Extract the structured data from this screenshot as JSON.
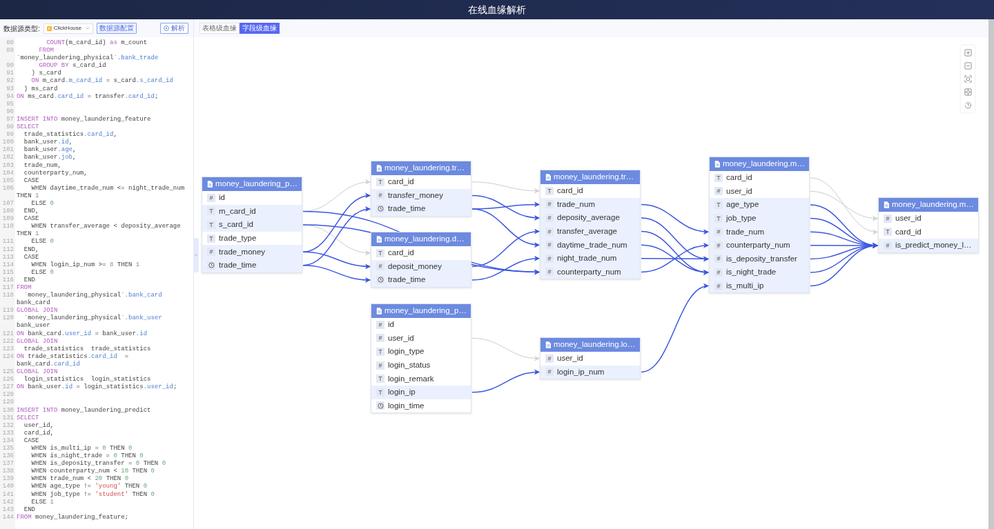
{
  "header": {
    "title": "在线血缘解析"
  },
  "toolbar": {
    "datasource_label": "数据源类型:",
    "datasource_value": "ClickHouse",
    "config_button": "数据源配置",
    "parse_button": "解析"
  },
  "view_tabs": [
    {
      "label": "表格级血缘",
      "selected": false
    },
    {
      "label": "字段级血缘",
      "selected": true
    }
  ],
  "collapse_handle": "<",
  "code": [
    {
      "n": "88",
      "parts": [
        {
          "kind": "kw",
          "text": "        COUNT"
        },
        {
          "kind": "txt",
          "text": "(m_card_id) "
        },
        {
          "kind": "kw",
          "text": "as"
        },
        {
          "kind": "txt",
          "text": " m_count"
        }
      ]
    },
    {
      "n": "89",
      "parts": [
        {
          "kind": "kw",
          "text": "      FROM"
        }
      ]
    },
    {
      "parts": [
        {
          "kind": "txt",
          "text": "`money_laundering_physical`"
        },
        {
          "kind": "fld",
          "text": ".bank_trade"
        }
      ]
    },
    {
      "n": "90",
      "parts": [
        {
          "kind": "kw",
          "text": "      GROUP BY"
        },
        {
          "kind": "txt",
          "text": " s_card_id"
        }
      ]
    },
    {
      "n": "91",
      "parts": [
        {
          "kind": "txt",
          "text": "    ) s_card"
        }
      ]
    },
    {
      "n": "92",
      "parts": [
        {
          "kind": "kw",
          "text": "    ON"
        },
        {
          "kind": "txt",
          "text": " m_card"
        },
        {
          "kind": "fld",
          "text": ".m_card_id"
        },
        {
          "kind": "txt",
          "text": " = s_card"
        },
        {
          "kind": "fld",
          "text": ".s_card_id"
        }
      ]
    },
    {
      "n": "93",
      "parts": [
        {
          "kind": "txt",
          "text": "  ) ms_card"
        }
      ]
    },
    {
      "n": "94",
      "parts": [
        {
          "kind": "kw",
          "text": "ON"
        },
        {
          "kind": "txt",
          "text": " ms_card"
        },
        {
          "kind": "fld",
          "text": ".card_id"
        },
        {
          "kind": "txt",
          "text": " = transfer"
        },
        {
          "kind": "fld",
          "text": ".card_id"
        },
        {
          "kind": "txt",
          "text": ";"
        }
      ]
    },
    {
      "n": "95"
    },
    {
      "n": "96"
    },
    {
      "n": "97",
      "parts": [
        {
          "kind": "kw",
          "text": "INSERT INTO"
        },
        {
          "kind": "txt",
          "text": " money_laundering_feature"
        }
      ]
    },
    {
      "n": "98",
      "parts": [
        {
          "kind": "kw",
          "text": "SELECT"
        }
      ]
    },
    {
      "n": "99",
      "parts": [
        {
          "kind": "txt",
          "text": "  trade_statistics"
        },
        {
          "kind": "fld",
          "text": ".card_id"
        },
        {
          "kind": "txt",
          "text": ","
        }
      ]
    },
    {
      "n": "100",
      "parts": [
        {
          "kind": "txt",
          "text": "  bank_user"
        },
        {
          "kind": "fld",
          "text": ".id"
        },
        {
          "kind": "txt",
          "text": ","
        }
      ]
    },
    {
      "n": "101",
      "parts": [
        {
          "kind": "txt",
          "text": "  bank_user"
        },
        {
          "kind": "fld",
          "text": ".age"
        },
        {
          "kind": "txt",
          "text": ","
        }
      ]
    },
    {
      "n": "102",
      "parts": [
        {
          "kind": "txt",
          "text": "  bank_user"
        },
        {
          "kind": "fld",
          "text": ".job"
        },
        {
          "kind": "txt",
          "text": ","
        }
      ]
    },
    {
      "n": "103",
      "parts": [
        {
          "kind": "txt",
          "text": "  trade_num,"
        }
      ]
    },
    {
      "n": "104",
      "parts": [
        {
          "kind": "txt",
          "text": "  counterparty_num,"
        }
      ]
    },
    {
      "n": "105",
      "parts": [
        {
          "kind": "txt",
          "text": "  CASE"
        }
      ]
    },
    {
      "n": "106",
      "parts": [
        {
          "kind": "txt",
          "text": "    WHEN daytime_trade_num <= night_trade_num"
        }
      ]
    },
    {
      "parts": [
        {
          "kind": "txt",
          "text": "THEN "
        },
        {
          "kind": "num",
          "text": "1"
        }
      ]
    },
    {
      "n": "107",
      "parts": [
        {
          "kind": "txt",
          "text": "    ELSE "
        },
        {
          "kind": "num",
          "text": "0"
        }
      ]
    },
    {
      "n": "108",
      "parts": [
        {
          "kind": "txt",
          "text": "  END,"
        }
      ]
    },
    {
      "n": "109",
      "parts": [
        {
          "kind": "txt",
          "text": "  CASE"
        }
      ]
    },
    {
      "n": "110",
      "parts": [
        {
          "kind": "txt",
          "text": "    WHEN transfer_average < deposity_average"
        }
      ]
    },
    {
      "parts": [
        {
          "kind": "txt",
          "text": "THEN "
        },
        {
          "kind": "num",
          "text": "1"
        }
      ]
    },
    {
      "n": "111",
      "parts": [
        {
          "kind": "txt",
          "text": "    ELSE "
        },
        {
          "kind": "num",
          "text": "0"
        }
      ]
    },
    {
      "n": "112",
      "parts": [
        {
          "kind": "txt",
          "text": "  END,"
        }
      ]
    },
    {
      "n": "113",
      "parts": [
        {
          "kind": "txt",
          "text": "  CASE"
        }
      ]
    },
    {
      "n": "114",
      "parts": [
        {
          "kind": "txt",
          "text": "    WHEN login_ip_num >= "
        },
        {
          "kind": "num",
          "text": "8"
        },
        {
          "kind": "txt",
          "text": " THEN "
        },
        {
          "kind": "num",
          "text": "1"
        }
      ]
    },
    {
      "n": "115",
      "parts": [
        {
          "kind": "txt",
          "text": "    ELSE "
        },
        {
          "kind": "num",
          "text": "0"
        }
      ]
    },
    {
      "n": "116",
      "parts": [
        {
          "kind": "txt",
          "text": "  END"
        }
      ]
    },
    {
      "n": "117",
      "parts": [
        {
          "kind": "kw",
          "text": "FROM"
        }
      ]
    },
    {
      "n": "118",
      "parts": [
        {
          "kind": "txt",
          "text": "  `money_laundering_physical`"
        },
        {
          "kind": "fld",
          "text": ".bank_card"
        }
      ]
    },
    {
      "parts": [
        {
          "kind": "txt",
          "text": "bank_card"
        }
      ]
    },
    {
      "n": "119",
      "parts": [
        {
          "kind": "kw",
          "text": "GLOBAL JOIN"
        }
      ]
    },
    {
      "n": "120",
      "parts": [
        {
          "kind": "txt",
          "text": "  `money_laundering_physical`"
        },
        {
          "kind": "fld",
          "text": ".bank_user"
        }
      ]
    },
    {
      "parts": [
        {
          "kind": "txt",
          "text": "bank_user"
        }
      ]
    },
    {
      "n": "121",
      "parts": [
        {
          "kind": "kw",
          "text": "ON"
        },
        {
          "kind": "txt",
          "text": " bank_card"
        },
        {
          "kind": "fld",
          "text": ".user_id"
        },
        {
          "kind": "txt",
          "text": " = bank_user"
        },
        {
          "kind": "fld",
          "text": ".id"
        }
      ]
    },
    {
      "n": "122",
      "parts": [
        {
          "kind": "kw",
          "text": "GLOBAL JOIN"
        }
      ]
    },
    {
      "n": "123",
      "parts": [
        {
          "kind": "txt",
          "text": "  trade_statistics  trade_statistics"
        }
      ]
    },
    {
      "n": "124",
      "parts": [
        {
          "kind": "kw",
          "text": "ON"
        },
        {
          "kind": "txt",
          "text": " trade_statistics"
        },
        {
          "kind": "fld",
          "text": ".card_id"
        },
        {
          "kind": "txt",
          "text": "  ="
        }
      ]
    },
    {
      "parts": [
        {
          "kind": "txt",
          "text": "bank_card"
        },
        {
          "kind": "fld",
          "text": ".card_id"
        }
      ]
    },
    {
      "n": "125",
      "parts": [
        {
          "kind": "kw",
          "text": "GLOBAL JOIN"
        }
      ]
    },
    {
      "n": "126",
      "parts": [
        {
          "kind": "txt",
          "text": "  login_statistics  login_statistics"
        }
      ]
    },
    {
      "n": "127",
      "parts": [
        {
          "kind": "kw",
          "text": "ON"
        },
        {
          "kind": "txt",
          "text": " bank_user"
        },
        {
          "kind": "fld",
          "text": ".id"
        },
        {
          "kind": "txt",
          "text": " = login_statistics"
        },
        {
          "kind": "fld",
          "text": ".user_id"
        },
        {
          "kind": "txt",
          "text": ";"
        }
      ]
    },
    {
      "n": "128"
    },
    {
      "n": "129"
    },
    {
      "n": "130",
      "parts": [
        {
          "kind": "kw",
          "text": "INSERT INTO"
        },
        {
          "kind": "txt",
          "text": " money_laundering_predict"
        }
      ]
    },
    {
      "n": "131",
      "parts": [
        {
          "kind": "kw",
          "text": "SELECT"
        }
      ]
    },
    {
      "n": "132",
      "parts": [
        {
          "kind": "txt",
          "text": "  user_id,"
        }
      ]
    },
    {
      "n": "133",
      "parts": [
        {
          "kind": "txt",
          "text": "  card_id,"
        }
      ]
    },
    {
      "n": "134",
      "parts": [
        {
          "kind": "txt",
          "text": "  CASE"
        }
      ]
    },
    {
      "n": "135",
      "parts": [
        {
          "kind": "txt",
          "text": "    WHEN is_multi_ip = "
        },
        {
          "kind": "num",
          "text": "0"
        },
        {
          "kind": "txt",
          "text": " THEN "
        },
        {
          "kind": "num",
          "text": "0"
        }
      ]
    },
    {
      "n": "136",
      "parts": [
        {
          "kind": "txt",
          "text": "    WHEN is_night_trade = "
        },
        {
          "kind": "num",
          "text": "0"
        },
        {
          "kind": "txt",
          "text": " THEN "
        },
        {
          "kind": "num",
          "text": "0"
        }
      ]
    },
    {
      "n": "137",
      "parts": [
        {
          "kind": "txt",
          "text": "    WHEN is_deposity_transfer = "
        },
        {
          "kind": "num",
          "text": "0"
        },
        {
          "kind": "txt",
          "text": " THEN "
        },
        {
          "kind": "num",
          "text": "0"
        }
      ]
    },
    {
      "n": "138",
      "parts": [
        {
          "kind": "txt",
          "text": "    WHEN counterparty_num < "
        },
        {
          "kind": "num",
          "text": "10"
        },
        {
          "kind": "txt",
          "text": " THEN "
        },
        {
          "kind": "num",
          "text": "0"
        }
      ]
    },
    {
      "n": "139",
      "parts": [
        {
          "kind": "txt",
          "text": "    WHEN trade_num < "
        },
        {
          "kind": "num",
          "text": "20"
        },
        {
          "kind": "txt",
          "text": " THEN "
        },
        {
          "kind": "num",
          "text": "0"
        }
      ]
    },
    {
      "n": "140",
      "parts": [
        {
          "kind": "txt",
          "text": "    WHEN age_type != "
        },
        {
          "kind": "str",
          "text": "'young'"
        },
        {
          "kind": "txt",
          "text": " THEN "
        },
        {
          "kind": "num",
          "text": "0"
        }
      ]
    },
    {
      "n": "141",
      "parts": [
        {
          "kind": "txt",
          "text": "    WHEN job_type != "
        },
        {
          "kind": "str",
          "text": "'student'"
        },
        {
          "kind": "txt",
          "text": " THEN "
        },
        {
          "kind": "num",
          "text": "0"
        }
      ]
    },
    {
      "n": "142",
      "parts": [
        {
          "kind": "txt",
          "text": "    ELSE "
        },
        {
          "kind": "num",
          "text": "1"
        }
      ]
    },
    {
      "n": "143",
      "parts": [
        {
          "kind": "txt",
          "text": "  END"
        }
      ]
    },
    {
      "n": "144",
      "parts": [
        {
          "kind": "kw",
          "text": "FROM"
        },
        {
          "kind": "txt",
          "text": " money_laundering_feature;"
        }
      ]
    }
  ],
  "tables": [
    {
      "title": "money_laundering_p…",
      "fields": [
        {
          "name": "id",
          "kind": "number",
          "glyph": "#",
          "highlighted": false
        },
        {
          "name": "m_card_id",
          "kind": "text",
          "glyph": "T",
          "highlighted": true
        },
        {
          "name": "s_card_id",
          "kind": "text",
          "glyph": "T",
          "highlighted": true
        },
        {
          "name": "trade_type",
          "kind": "text",
          "glyph": "T",
          "highlighted": false
        },
        {
          "name": "trade_money",
          "kind": "number",
          "glyph": "#",
          "highlighted": true
        },
        {
          "name": "trade_time",
          "kind": "time",
          "highlighted": true
        }
      ]
    },
    {
      "title": "money_laundering.tr…",
      "fields": [
        {
          "name": "card_id",
          "kind": "text",
          "glyph": "T",
          "highlighted": false
        },
        {
          "name": "transfer_money",
          "kind": "number",
          "glyph": "#",
          "highlighted": true
        },
        {
          "name": "trade_time",
          "kind": "time",
          "highlighted": true
        }
      ]
    },
    {
      "title": "money_laundering.d…",
      "fields": [
        {
          "name": "card_id",
          "kind": "text",
          "glyph": "T",
          "highlighted": false
        },
        {
          "name": "deposit_money",
          "kind": "number",
          "glyph": "#",
          "highlighted": true
        },
        {
          "name": "trade_time",
          "kind": "time",
          "highlighted": true
        }
      ]
    },
    {
      "title": "money_laundering_p…",
      "fields": [
        {
          "name": "id",
          "kind": "number",
          "glyph": "#",
          "highlighted": false
        },
        {
          "name": "user_id",
          "kind": "number",
          "glyph": "#",
          "highlighted": false
        },
        {
          "name": "login_type",
          "kind": "text",
          "glyph": "T",
          "highlighted": false
        },
        {
          "name": "login_status",
          "kind": "number",
          "glyph": "#",
          "highlighted": false
        },
        {
          "name": "login_remark",
          "kind": "text",
          "glyph": "T",
          "highlighted": false
        },
        {
          "name": "login_ip",
          "kind": "text",
          "glyph": "T",
          "highlighted": true
        },
        {
          "name": "login_time",
          "kind": "time",
          "highlighted": false
        }
      ]
    },
    {
      "title": "money_laundering.tr…",
      "fields": [
        {
          "name": "card_id",
          "kind": "text",
          "glyph": "T",
          "highlighted": false
        },
        {
          "name": "trade_num",
          "kind": "number",
          "glyph": "#",
          "highlighted": true
        },
        {
          "name": "deposity_average",
          "kind": "number",
          "glyph": "#",
          "highlighted": true
        },
        {
          "name": "transfer_average",
          "kind": "number",
          "glyph": "#",
          "highlighted": true
        },
        {
          "name": "daytime_trade_num",
          "kind": "number",
          "glyph": "#",
          "highlighted": true
        },
        {
          "name": "night_trade_num",
          "kind": "number",
          "glyph": "#",
          "highlighted": true
        },
        {
          "name": "counterparty_num",
          "kind": "number",
          "glyph": "#",
          "highlighted": true
        }
      ]
    },
    {
      "title": "money_laundering.lo…",
      "fields": [
        {
          "name": "user_id",
          "kind": "number",
          "glyph": "#",
          "highlighted": false
        },
        {
          "name": "login_ip_num",
          "kind": "number",
          "glyph": "#",
          "highlighted": true
        }
      ]
    },
    {
      "title": "money_laundering.m…",
      "fields": [
        {
          "name": "card_id",
          "kind": "text",
          "glyph": "T",
          "highlighted": false
        },
        {
          "name": "user_id",
          "kind": "number",
          "glyph": "#",
          "highlighted": false
        },
        {
          "name": "age_type",
          "kind": "text",
          "glyph": "T",
          "highlighted": true
        },
        {
          "name": "job_type",
          "kind": "text",
          "glyph": "T",
          "highlighted": true
        },
        {
          "name": "trade_num",
          "kind": "number",
          "glyph": "#",
          "highlighted": true
        },
        {
          "name": "counterparty_num",
          "kind": "number",
          "glyph": "#",
          "highlighted": true
        },
        {
          "name": "is_deposity_transfer",
          "kind": "number",
          "glyph": "#",
          "highlighted": true
        },
        {
          "name": "is_night_trade",
          "kind": "number",
          "glyph": "#",
          "highlighted": true
        },
        {
          "name": "is_multi_ip",
          "kind": "number",
          "glyph": "#",
          "highlighted": true
        }
      ]
    },
    {
      "title": "money_laundering.m…",
      "fields": [
        {
          "name": "user_id",
          "kind": "number",
          "glyph": "#",
          "highlighted": false
        },
        {
          "name": "card_id",
          "kind": "text",
          "glyph": "T",
          "highlighted": false
        },
        {
          "name": "is_predict_money_l…",
          "kind": "number",
          "glyph": "#",
          "highlighted": true
        }
      ]
    }
  ]
}
